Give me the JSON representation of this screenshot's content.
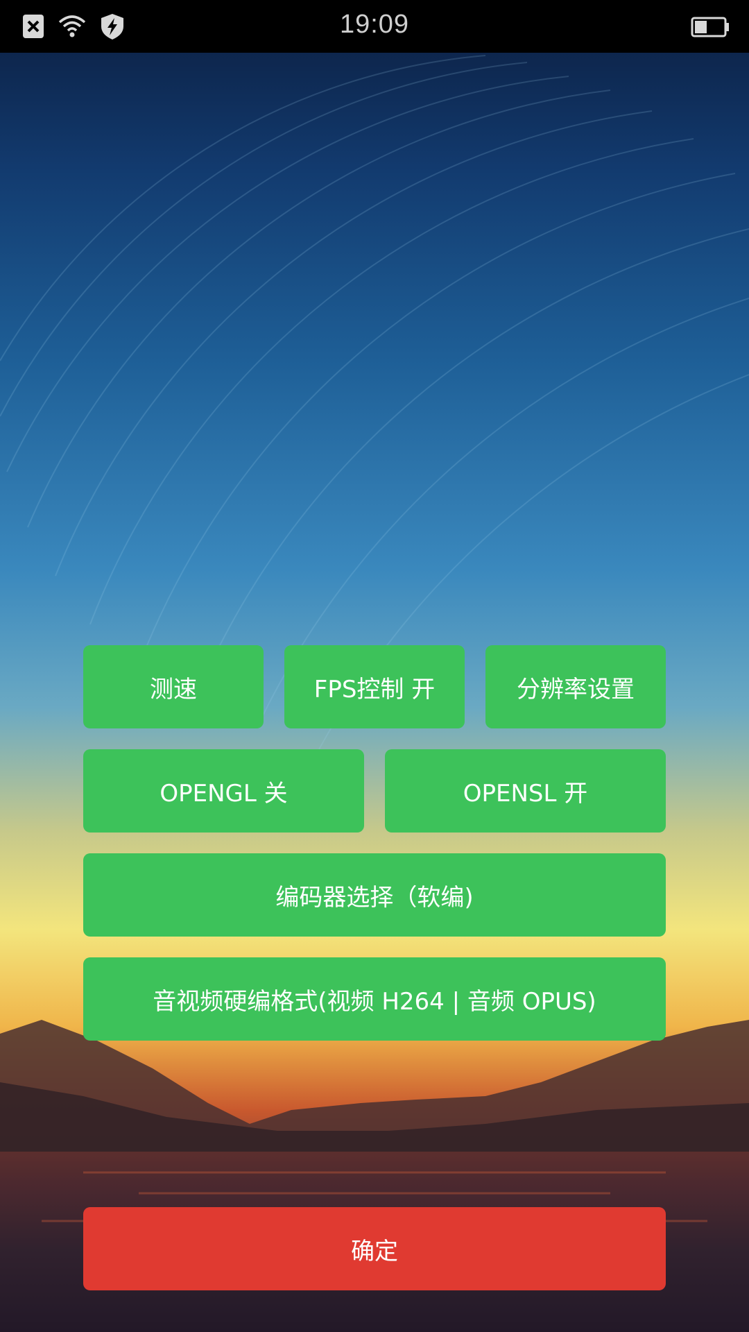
{
  "status_bar": {
    "time": "19:09",
    "icons": [
      "close-notification-icon",
      "wifi-icon",
      "shield-bolt-icon",
      "battery-icon"
    ]
  },
  "buttons": {
    "speed_test": "测速",
    "fps_control": "FPS控制 开",
    "resolution": "分辨率设置",
    "opengl": "OPENGL 关",
    "opensl": "OPENSL 开",
    "encoder": "编码器选择（软编)",
    "hw_format": "音视频硬编格式(视频 H264 | 音频 OPUS)",
    "confirm": "确定"
  },
  "colors": {
    "button_green": "#3dc25a",
    "button_red": "#e03a31",
    "status_bar": "#000000"
  }
}
